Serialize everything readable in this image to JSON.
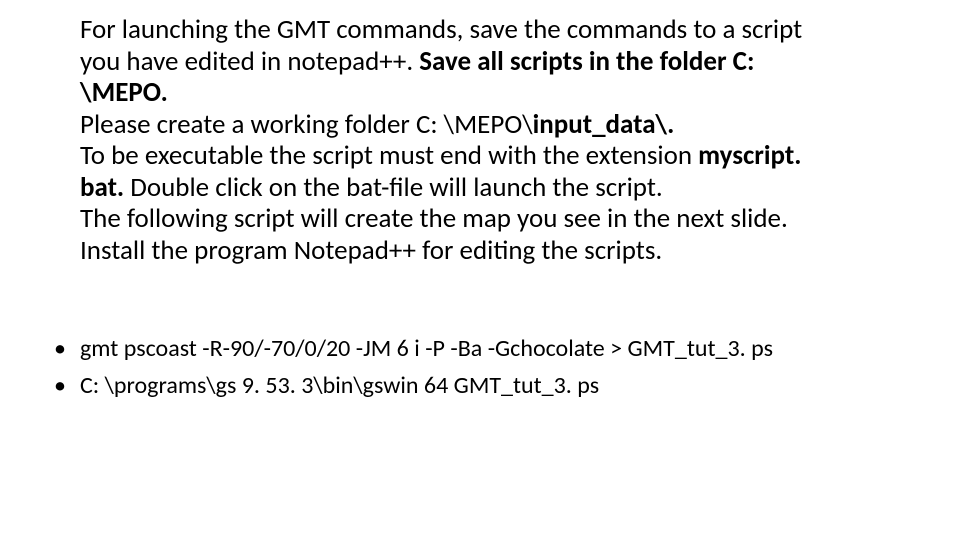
{
  "body": {
    "p1a": "For launching the GMT commands, save the commands to a script you have edited in notepad++. ",
    "p1b": "Save all scripts in the folder C: \\MEPO.",
    "p2a": "Please create a working folder C: \\MEPO\\",
    "p2b": "input_data\\.",
    "p3a": "To be executable the script must end with the extension ",
    "p3b": "myscript. bat.",
    "p3c": " Double click on the bat-file will launch the script.",
    "p4": "The following script will create the map you see in the next slide.",
    "p5": "Install the program Notepad++ for editing the scripts."
  },
  "bullets": {
    "dot": "•",
    "b1": "gmt pscoast -R-90/-70/0/20 -JM 6 i -P -Ba -Gchocolate > GMT_tut_3. ps",
    "b2": "C: \\programs\\gs 9. 53. 3\\bin\\gswin 64 GMT_tut_3. ps"
  }
}
